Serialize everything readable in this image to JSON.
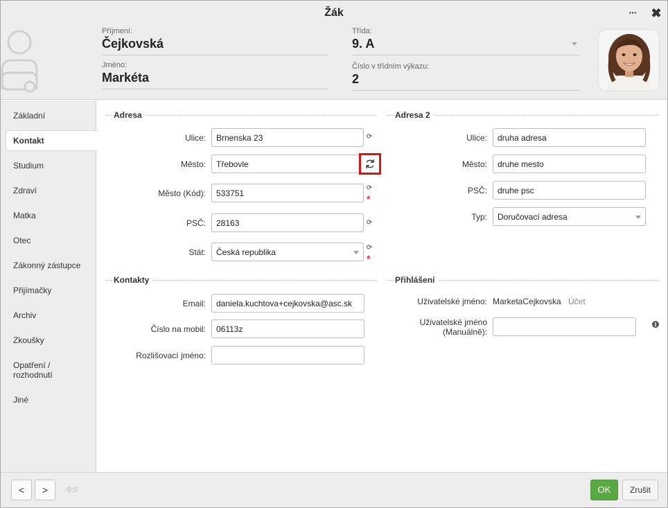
{
  "window": {
    "title": "Žák",
    "more_label": "···",
    "close_label": "✖"
  },
  "header": {
    "surname_label": "Příjmení:",
    "surname": "Čejkovská",
    "firstname_label": "Jméno:",
    "firstname": "Markéta",
    "class_label": "Třída:",
    "class": "9. A",
    "register_label": "Číslo v třídním výkazu:",
    "register_number": "2"
  },
  "sidebar": {
    "items": [
      {
        "label": "Základní"
      },
      {
        "label": "Kontakt"
      },
      {
        "label": "Studium"
      },
      {
        "label": "Zdraví"
      },
      {
        "label": "Matka"
      },
      {
        "label": "Otec"
      },
      {
        "label": "Zákonný zástupce"
      },
      {
        "label": "Přijímačky"
      },
      {
        "label": "Archiv"
      },
      {
        "label": "Zkoušky"
      },
      {
        "label": "Opatření / rozhodnutí"
      },
      {
        "label": "Jiné"
      }
    ],
    "active": "Kontakt"
  },
  "address": {
    "title": "Adresa",
    "street_label": "Ulice:",
    "street": "Brnenska 23",
    "city_label": "Město:",
    "city": "Třebovle",
    "city_code_label": "Město (Kód):",
    "city_code": "533751",
    "zip_label": "PSČ:",
    "zip": "28163",
    "country_label": "Stát:",
    "country": "Česká republika",
    "required_mark": "*"
  },
  "address2": {
    "title": "Adresa 2",
    "street_label": "Ulice:",
    "street": "druha adresa",
    "city_label": "Město:",
    "city": "druhe mesto",
    "zip_label": "PSČ:",
    "zip": "druhe psc",
    "type_label": "Typ:",
    "type": "Doručovací adresa"
  },
  "contacts": {
    "title": "Kontakty",
    "email_label": "Email:",
    "email": "daniela.kuchtova+cejkovska@asc.sk",
    "mobile_label": "Číslo na mobil:",
    "mobile": "06113z",
    "distinct_name_label": "Rozlišovací jméno:",
    "distinct_name": ""
  },
  "login": {
    "title": "Přihlášení",
    "username_label": "Uživatelské jméno:",
    "username": "MarketaCejkovska",
    "account_link": "Účet",
    "manual_username_label_line1": "Uživatelské jméno",
    "manual_username_label_line2": "(Manuálně):",
    "manual_username": ""
  },
  "footer": {
    "prev_label": "<",
    "next_label": ">",
    "record_counter": "-9:0",
    "ok_label": "OK",
    "cancel_label": "Zrušit"
  },
  "icons": {
    "refresh": "refresh-icon",
    "info": "info-icon",
    "user_placeholder": "user-placeholder-icon"
  },
  "colors": {
    "ok_button": "#58a942",
    "required": "#e53935",
    "highlight_box": "#e01010"
  }
}
